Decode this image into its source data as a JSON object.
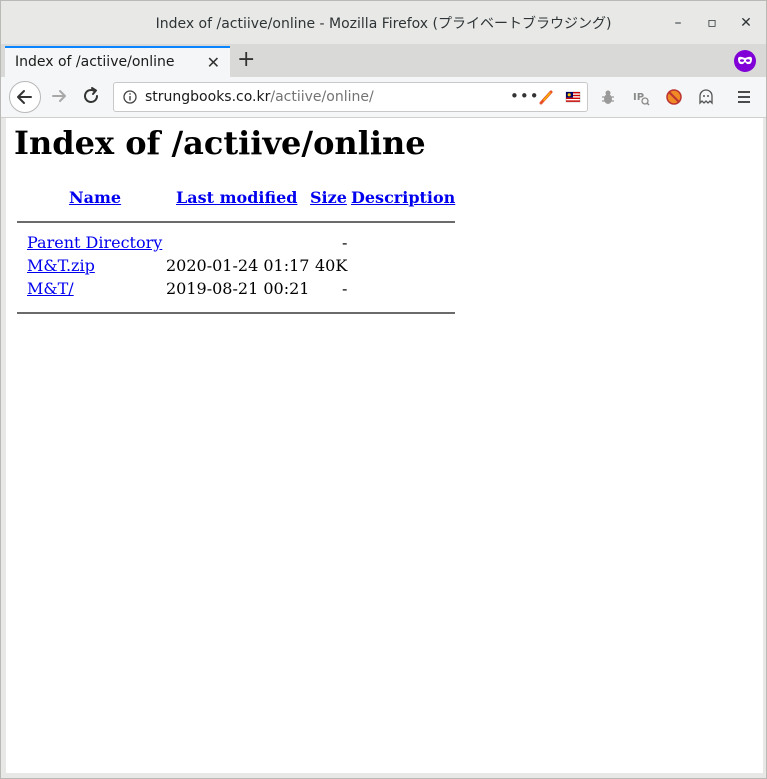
{
  "window": {
    "title": "Index of /actiive/online - Mozilla Firefox (プライベートブラウジング)",
    "minimize": "–",
    "maximize": "▫",
    "close": "✕"
  },
  "tabs": [
    {
      "label": "Index of /actiive/online",
      "close": "✕"
    }
  ],
  "newtab_label": "+",
  "url": {
    "domain": "strungbooks.co.kr",
    "path": "/actiive/online/",
    "more": "•••"
  },
  "page": {
    "heading": "Index of /actiive/online",
    "columns": {
      "name": "Name",
      "last_modified": "Last modified",
      "size": "Size",
      "description": "Description"
    },
    "rows": [
      {
        "name": "Parent Directory",
        "modified": "",
        "size": "-"
      },
      {
        "name": "M&T.zip",
        "modified": "2020-01-24 01:17",
        "size": "40K"
      },
      {
        "name": "M&T/",
        "modified": "2019-08-21 00:21",
        "size": "-"
      }
    ]
  },
  "colors": {
    "link": "#0000ee",
    "tab_accent": "#0a84ff",
    "private_badge": "#8000d7"
  }
}
